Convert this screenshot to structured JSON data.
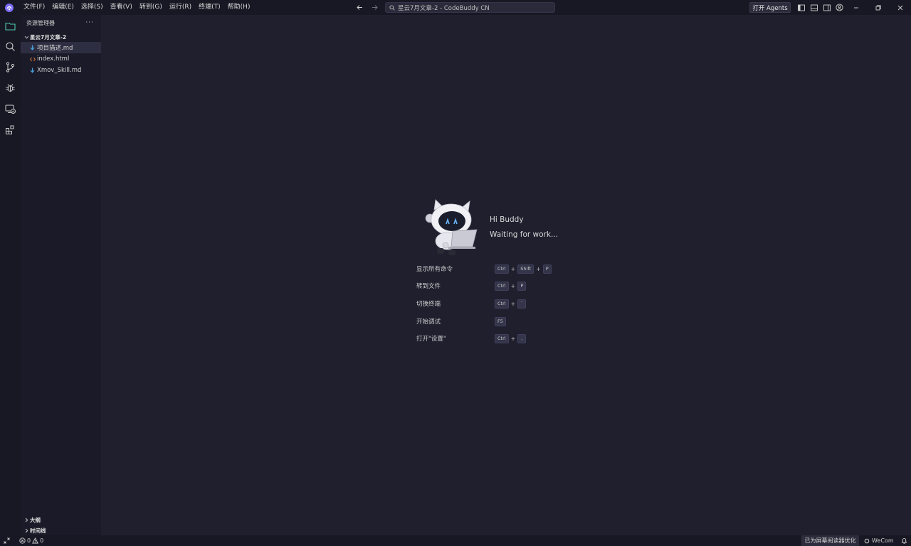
{
  "titlebar": {
    "menus": [
      "文件(F)",
      "编辑(E)",
      "选择(S)",
      "查看(V)",
      "转到(G)",
      "运行(R)",
      "终端(T)",
      "帮助(H)"
    ],
    "command_center": "星云7月文章-2 - CodeBuddy CN",
    "agents_button": "打开 Agents"
  },
  "sidebar": {
    "header": "资源管理器",
    "more": "···",
    "folder": "星云7月文章-2",
    "files": [
      {
        "name": "项目描述.md",
        "type": "md",
        "selected": true
      },
      {
        "name": "index.html",
        "type": "html",
        "selected": false
      },
      {
        "name": "Xmov_Skill.md",
        "type": "md",
        "selected": false
      }
    ],
    "outline": "大纲",
    "timeline": "时间线"
  },
  "welcome": {
    "greeting": "Hi Buddy",
    "status": "Waiting for work...",
    "shortcuts": [
      {
        "label": "显示所有命令",
        "keys": [
          "Ctrl",
          "Shift",
          "P"
        ]
      },
      {
        "label": "转到文件",
        "keys": [
          "Ctrl",
          "P"
        ]
      },
      {
        "label": "切换终端",
        "keys": [
          "Ctrl",
          "`"
        ]
      },
      {
        "label": "开始调试",
        "keys": [
          "F5"
        ]
      },
      {
        "label": "打开\"设置\"",
        "keys": [
          "Ctrl",
          ","
        ]
      }
    ]
  },
  "statusbar": {
    "errors": "0",
    "warnings": "0",
    "screen_reader": "已为屏幕阅读器优化",
    "wecom": "WeCom"
  },
  "colors": {
    "editor_bg": "#1f1f2e",
    "sidebar_bg": "#1a1a28",
    "activity_bg": "#181824",
    "accent_green": "#4ec9b0"
  }
}
